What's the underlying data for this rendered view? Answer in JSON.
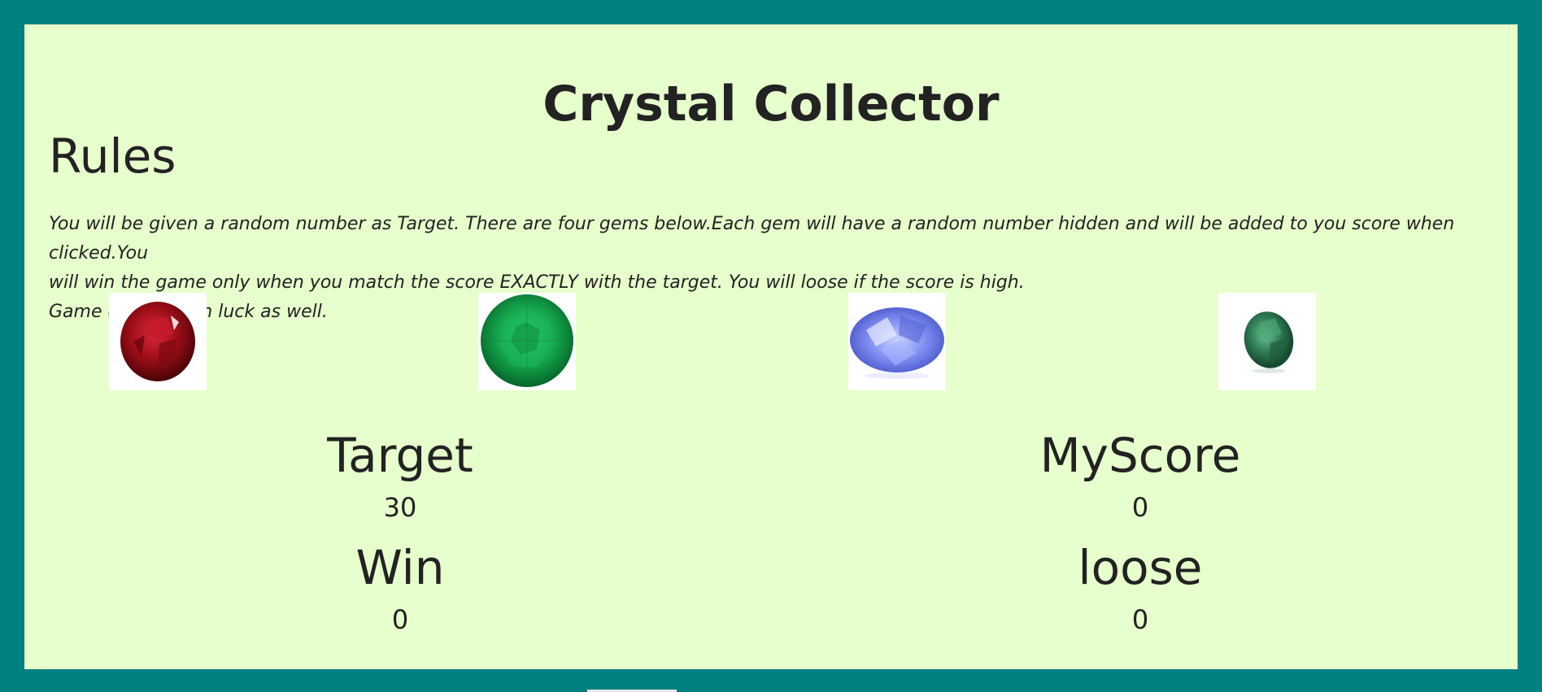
{
  "game": {
    "title": "Crystal Collector",
    "rules_heading": "Rules",
    "rules_lines": [
      "You will be given a random number as Target. There are four gems below.Each gem will have a random number hidden and will be added to you score when clicked.You",
      "will win the game only when you match the score EXACTLY with the target. You will loose if the score is high.",
      "Game depends on luck as well."
    ],
    "gems": [
      {
        "name": "ruby",
        "icon": "red-gem-icon",
        "color": "#9b0d17"
      },
      {
        "name": "emerald",
        "icon": "green-gem-icon",
        "color": "#12a24a"
      },
      {
        "name": "sapphire",
        "icon": "blue-gem-icon",
        "color": "#6f7fe6"
      },
      {
        "name": "alexandrite",
        "icon": "teal-gem-icon",
        "color": "#2f7d55"
      }
    ],
    "stats": {
      "target_label": "Target",
      "target_value": "30",
      "score_label": "MyScore",
      "score_value": "0",
      "win_label": "Win",
      "win_value": "0",
      "loose_label": "loose",
      "loose_value": "0"
    }
  },
  "colors": {
    "frame": "#008080",
    "panel": "#e6ffcc",
    "text": "#222222"
  }
}
